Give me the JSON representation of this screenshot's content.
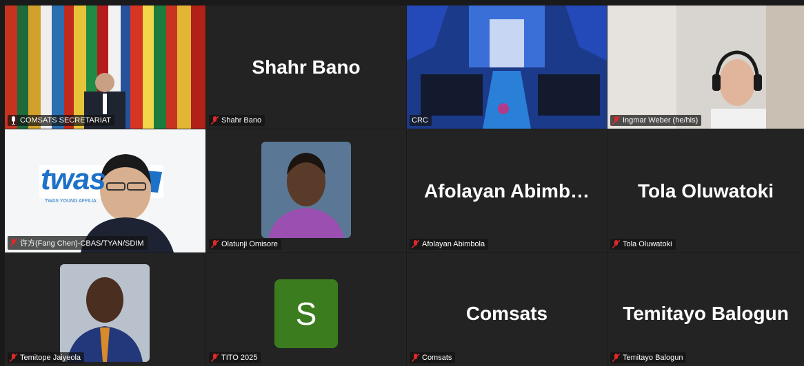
{
  "participants": [
    {
      "name": "COMSATS SECRETARIAT",
      "display": "",
      "active": true,
      "video": true
    },
    {
      "name": "Shahr Bano",
      "display": "Shahr Bano",
      "active": false,
      "video": false
    },
    {
      "name": "CRC",
      "display": "",
      "active": false,
      "video": true
    },
    {
      "name": "Ingmar Weber (he/his)",
      "display": "",
      "active": false,
      "video": true
    },
    {
      "name": "许方(Fang Chen)-CBAS/TYAN/SDIM",
      "display": "",
      "active": false,
      "video": true
    },
    {
      "name": "Olatunji Omisore",
      "display": "",
      "active": false,
      "video": true
    },
    {
      "name": "Afolayan Abimbola",
      "display": "Afolayan  Abimb…",
      "active": false,
      "video": false
    },
    {
      "name": "Tola Oluwatoki",
      "display": "Tola Oluwatoki",
      "active": false,
      "video": false
    },
    {
      "name": "Temitope Jaiyeola",
      "display": "",
      "active": false,
      "video": true
    },
    {
      "name": "TITO 2025",
      "display": "S",
      "active": false,
      "video": false
    },
    {
      "name": "Comsats",
      "display": "Comsats",
      "active": false,
      "video": false
    },
    {
      "name": "Temitayo Balogun",
      "display": "Temitayo Balogun",
      "active": false,
      "video": false
    }
  ],
  "logo": {
    "text": "twas",
    "subtext": "TWAS YOUNG AFFILIA"
  },
  "colors": {
    "active_border": "#2ea05a",
    "muted_mic": "#e02828",
    "avatar_bg": "#3b7d1e"
  }
}
